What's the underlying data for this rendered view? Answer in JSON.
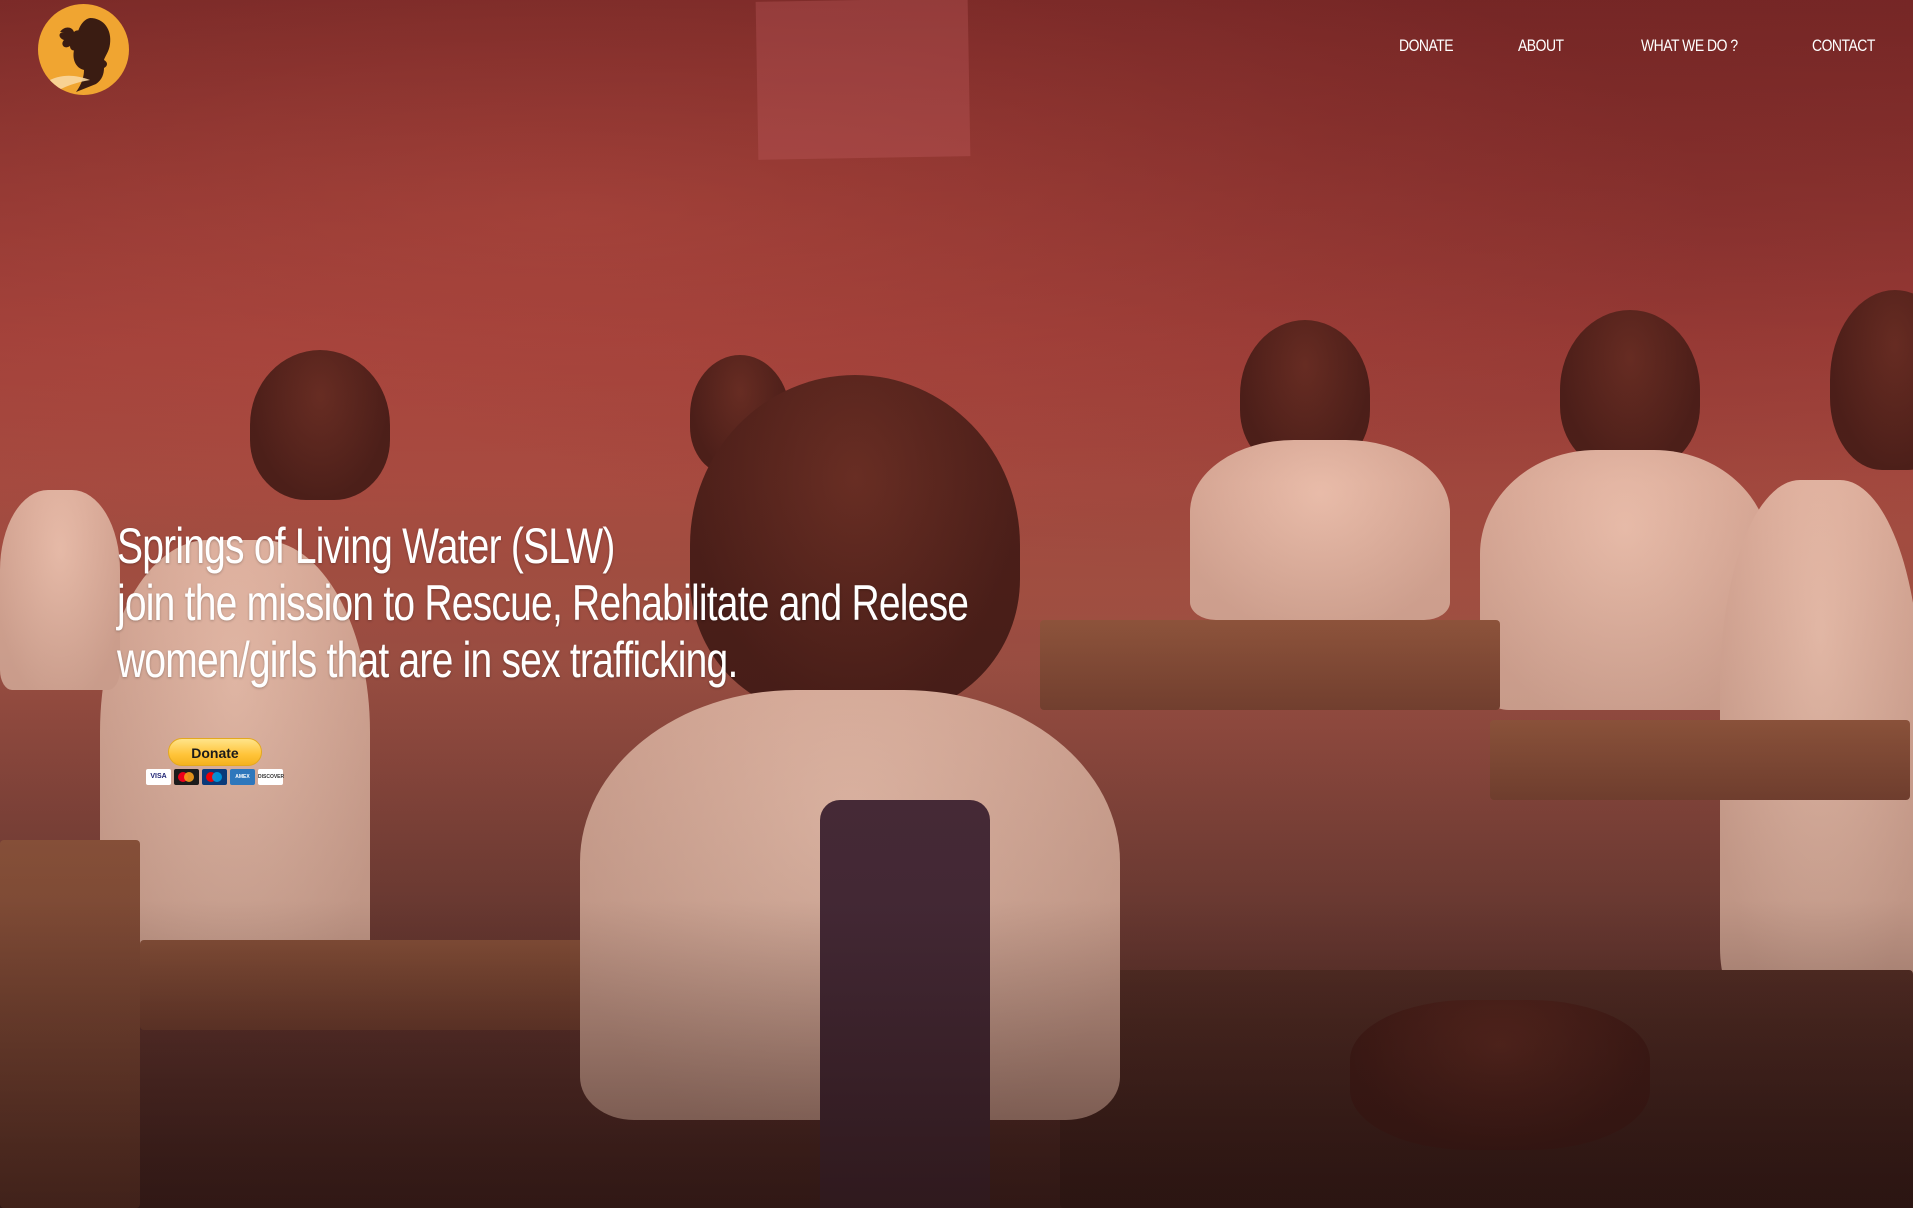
{
  "header": {
    "logo_alt": "Springs of Living Water logo",
    "nav": [
      {
        "label": "DONATE"
      },
      {
        "label": "ABOUT"
      },
      {
        "label": "WHAT WE DO ?"
      },
      {
        "label": "CONTACT"
      }
    ]
  },
  "hero": {
    "line1": "Springs of Living Water (SLW)",
    "line2": "join the mission to Rescue, Rehabilitate and Relese",
    "line3": "women/girls that are in sex trafficking."
  },
  "donate": {
    "button_label": "Donate",
    "cards": [
      {
        "label": "VISA",
        "icon": "visa-icon"
      },
      {
        "label": "",
        "icon": "mastercard-icon"
      },
      {
        "label": "",
        "icon": "maestro-icon"
      },
      {
        "label": "AMEX",
        "icon": "amex-icon"
      },
      {
        "label": "DISCOVER",
        "icon": "discover-icon"
      }
    ]
  },
  "colors": {
    "logo_bg": "#f0a531",
    "button_bg": "#ffc439",
    "overlay_tint": "#a5443d",
    "text": "#ffffff"
  }
}
